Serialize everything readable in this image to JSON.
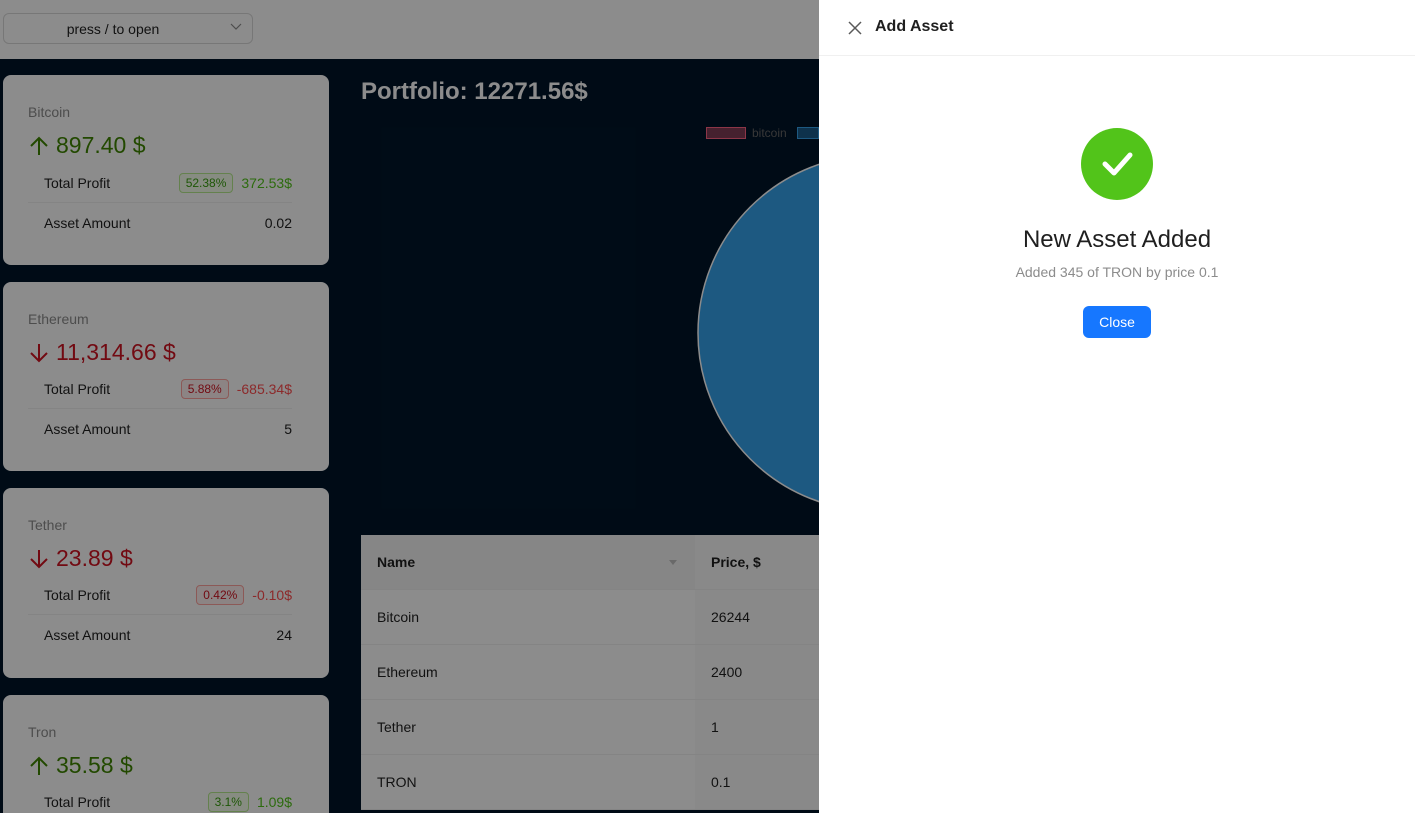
{
  "header": {
    "select_placeholder": "press / to open"
  },
  "cards": [
    {
      "name": "Bitcoin",
      "trend": "up",
      "price": "897.40 $",
      "profit_label": "Total Profit",
      "percent": "52.38%",
      "profit": "372.53$",
      "amount_label": "Asset Amount",
      "amount": "0.02"
    },
    {
      "name": "Ethereum",
      "trend": "down",
      "price": "11,314.66 $",
      "profit_label": "Total Profit",
      "percent": "5.88%",
      "profit": "-685.34$",
      "amount_label": "Asset Amount",
      "amount": "5"
    },
    {
      "name": "Tether",
      "trend": "down",
      "price": "23.89 $",
      "profit_label": "Total Profit",
      "percent": "0.42%",
      "profit": "-0.10$",
      "amount_label": "Asset Amount",
      "amount": "24"
    },
    {
      "name": "Tron",
      "trend": "up",
      "price": "35.58 $",
      "profit_label": "Total Profit",
      "percent": "3.1%",
      "profit": "1.09$"
    }
  ],
  "main": {
    "portfolio_title": "Portfolio: 12271.56$",
    "legend": [
      {
        "label": "bitcoin",
        "color": "#ff6384"
      }
    ]
  },
  "table": {
    "headers": [
      "Name",
      "Price, $"
    ],
    "rows": [
      [
        "Bitcoin",
        "26244"
      ],
      [
        "Ethereum",
        "2400"
      ],
      [
        "Tether",
        "1"
      ],
      [
        "TRON",
        "0.1"
      ]
    ]
  },
  "drawer": {
    "title": "Add Asset",
    "result_title": "New Asset Added",
    "result_subtitle": "Added 345 of TRON by price 0.1",
    "close_button": "Close"
  },
  "colors": {
    "up": "#3f8600",
    "down": "#cf1322",
    "success": "#52c41a",
    "primary": "#1677ff",
    "pie_fill": "#36a2eb"
  }
}
